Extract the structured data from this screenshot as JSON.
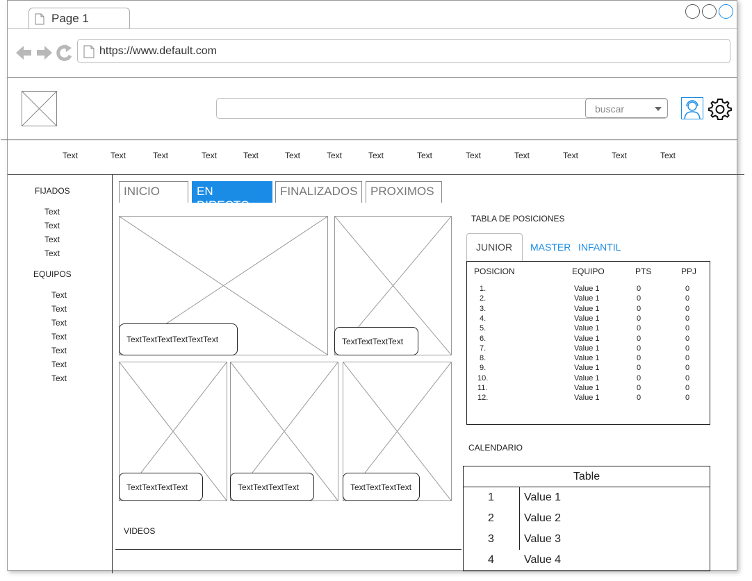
{
  "browser": {
    "tab_title": "Page 1",
    "url": "https://www.default.com"
  },
  "header": {
    "search_value": "",
    "search_dropdown": "buscar"
  },
  "menu": [
    "Text",
    "Text",
    "Text",
    "Text",
    "Text",
    "Text",
    "Text",
    "Text",
    "Text",
    "Text",
    "Text",
    "Text",
    "Text",
    "Text"
  ],
  "sidebar": {
    "fijados_title": "FIJADOS",
    "fijados": [
      "Text",
      "Text",
      "Text",
      "Text"
    ],
    "equipos_title": "EQUIPOS",
    "equipos": [
      "Text",
      "Text",
      "Text",
      "Text",
      "Text",
      "Text",
      "Text"
    ]
  },
  "page_tabs": [
    "INICIO",
    "EN DIRECTO",
    "FINALIZADOS",
    "PROXIMOS"
  ],
  "active_tab": "EN DIRECTO",
  "media": {
    "captions": [
      "TextTextTextTextTextText",
      "TextTextTextText",
      "TextTextTextText",
      "TextTextTextText",
      "TextTextTextText"
    ],
    "videos_label": "VIDEOS"
  },
  "standings": {
    "title": "TABLA DE POSICIONES",
    "tabs": [
      "JUNIOR",
      "MASTER",
      "INFANTIL"
    ],
    "columns": [
      "POSICION",
      "EQUIPO",
      "PTS",
      "PPJ"
    ],
    "rows": [
      [
        "1.",
        "Value 1",
        "0",
        "0"
      ],
      [
        "2.",
        "Value 1",
        "0",
        "0"
      ],
      [
        "3.",
        "Value 1",
        "0",
        "0"
      ],
      [
        "4.",
        "Value 1",
        "0",
        "0"
      ],
      [
        "5.",
        "Value 1",
        "0",
        "0"
      ],
      [
        "6.",
        "Value 1",
        "0",
        "0"
      ],
      [
        "7.",
        "Value 1",
        "0",
        "0"
      ],
      [
        "8.",
        "Value 1",
        "0",
        "0"
      ],
      [
        "9.",
        "Value 1",
        "0",
        "0"
      ],
      [
        "10.",
        "Value 1",
        "0",
        "0"
      ],
      [
        "11.",
        "Value 1",
        "0",
        "0"
      ],
      [
        "12.",
        "Value 1",
        "0",
        "0"
      ]
    ]
  },
  "calendar": {
    "title": "CALENDARIO",
    "table_title": "Table",
    "rows": [
      [
        "1",
        "Value 1"
      ],
      [
        "2",
        "Value 2"
      ],
      [
        "3",
        "Value 3"
      ],
      [
        "4",
        "Value 4"
      ]
    ]
  },
  "colors": {
    "accent": "#1a8ce6"
  }
}
